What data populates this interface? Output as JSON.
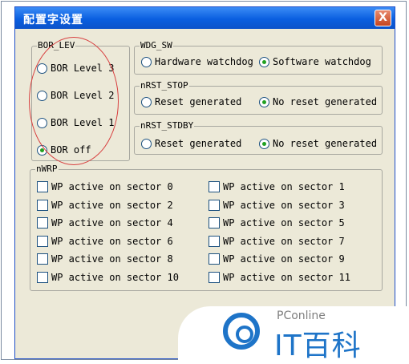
{
  "window": {
    "title": "配置字设置",
    "close_label": "X"
  },
  "bor_lev": {
    "legend": "BOR_LEV",
    "options": [
      {
        "label": "BOR Level 3",
        "checked": false
      },
      {
        "label": "BOR Level 2",
        "checked": false
      },
      {
        "label": "BOR Level 1",
        "checked": false
      },
      {
        "label": "BOR off",
        "checked": true
      }
    ]
  },
  "wdg_sw": {
    "legend": "WDG_SW",
    "options": [
      {
        "label": "Hardware watchdog",
        "checked": false
      },
      {
        "label": "Software watchdog",
        "checked": true
      }
    ]
  },
  "nrst_stop": {
    "legend": "nRST_STOP",
    "options": [
      {
        "label": "Reset generated",
        "checked": false
      },
      {
        "label": "No reset generated",
        "checked": true
      }
    ]
  },
  "nrst_stdby": {
    "legend": "nRST_STDBY",
    "options": [
      {
        "label": "Reset generated",
        "checked": false
      },
      {
        "label": "No reset generated",
        "checked": true
      }
    ]
  },
  "nwrp": {
    "legend": "nWRP",
    "sectors": [
      "WP active on sector 0",
      "WP active on sector 1",
      "WP active on sector 2",
      "WP active on sector 3",
      "WP active on sector 4",
      "WP active on sector 5",
      "WP active on sector 6",
      "WP active on sector 7",
      "WP active on sector 8",
      "WP active on sector 9",
      "WP active on sector 10",
      "WP active on sector 11"
    ]
  },
  "watermark": {
    "brand_small": "PConline",
    "brand_big": "IT百科"
  },
  "colors": {
    "title_bar": "#0a5fe0",
    "annotation_circle": "#d84040",
    "watermark": "#1e74c8"
  }
}
